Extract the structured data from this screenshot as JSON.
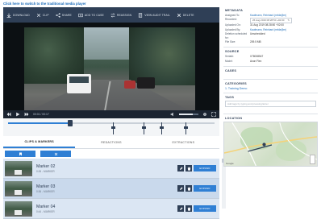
{
  "top_link": "Click here to switch to the traditional media player",
  "toolbar": {
    "buttons": [
      {
        "label": "DOWNLOAD",
        "icon": "download-icon"
      },
      {
        "label": "CLIP",
        "icon": "clip-icon"
      },
      {
        "label": "SHARE",
        "icon": "share-icon"
      },
      {
        "label": "ADD TO CASE",
        "icon": "add-to-case-icon"
      },
      {
        "label": "REASSIGN",
        "icon": "reassign-icon"
      },
      {
        "label": "VIEW AUDIT TRAIL",
        "icon": "audit-trail-icon"
      },
      {
        "label": "DELETE",
        "icon": "delete-icon"
      }
    ]
  },
  "player": {
    "time": "00:01 / 00:17",
    "volume_level": 0.7,
    "progress_fraction": 0.3
  },
  "tabs": [
    {
      "label": "CLIPS & MARKERS",
      "active": true
    },
    {
      "label": "REDACTIONS",
      "active": false
    },
    {
      "label": "EXTRACTIONS",
      "active": false
    }
  ],
  "markers": [
    {
      "title": "Marker 02",
      "sub": "0:26 - MARKER",
      "edit": "EXPAND"
    },
    {
      "title": "Marker 03",
      "sub": "0:36 - MARKER",
      "edit": "EXPAND"
    },
    {
      "title": "Marker 04",
      "sub": "0:44 - MARKER",
      "edit": "EXPAND"
    }
  ],
  "metadata": {
    "title": "METADATA",
    "rows": [
      {
        "k": "Assigned To:",
        "v": "Kaufmann, Reinhard (rekfa@m)",
        "link": true
      },
      {
        "k": "Recorded:",
        "v": "26 Aug 2019 08:28:50 +02:00",
        "box": true
      },
      {
        "k": "Uploaded On:",
        "v": "31 Aug 2019 08:28:50 +02:00"
      },
      {
        "k": "Uploaded By:",
        "v": "Kaufmann, Reinhard (rekfa@m)",
        "link": true
      },
      {
        "k": "Deletion scheduled for:",
        "v": "Unscheduled"
      },
      {
        "k": "File Size:",
        "v": "209.5 MB"
      }
    ]
  },
  "source": {
    "title": "SOURCE",
    "rows": [
      {
        "k": "Serial#:",
        "v": "X78008547"
      },
      {
        "k": "Model:",
        "v": "Axon Flex"
      }
    ]
  },
  "cases": {
    "title": "CASES"
  },
  "categories": {
    "title": "CATEGORIES",
    "items": [
      "1. Training Demo"
    ]
  },
  "tags": {
    "title": "TAGS",
    "placeholder": "Add tags by typing and pressing Enter"
  },
  "location": {
    "title": "LOCATION",
    "attribution": "Google"
  },
  "colors": {
    "accent": "#2f7fd4",
    "toolbar": "#2f3f56"
  }
}
